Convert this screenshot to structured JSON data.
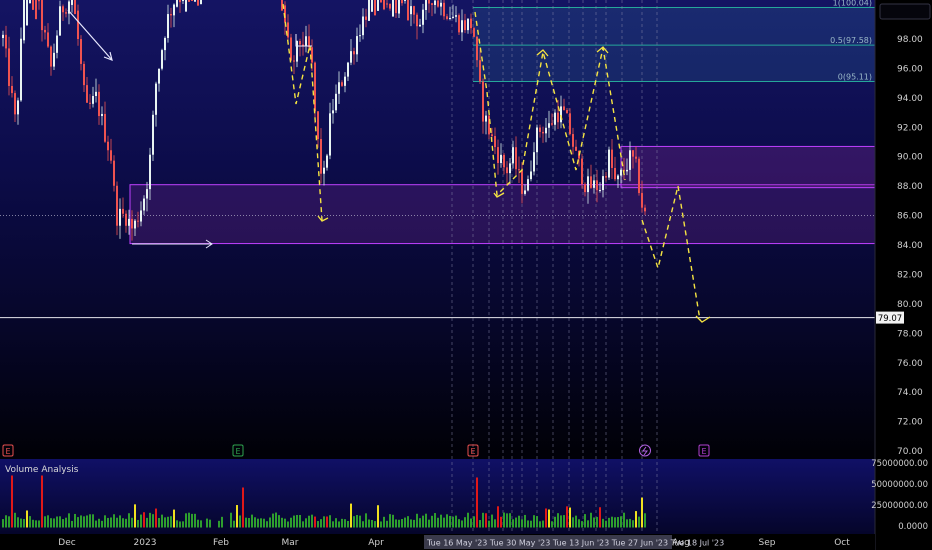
{
  "chart_data": {
    "type": "candlestick",
    "price_axis": {
      "ticks": [
        "98.00",
        "96.00",
        "94.00",
        "92.00",
        "90.00",
        "88.00",
        "86.00",
        "84.00",
        "82.00",
        "80.00",
        "78.00",
        "76.00",
        "74.00",
        "72.00",
        "70.00"
      ],
      "range": [
        69.2,
        100.6
      ]
    },
    "price_label": "79.07",
    "price_level": 79.07,
    "time_axis": {
      "ticks": [
        "Dec",
        "2023",
        "Feb",
        "Mar",
        "Apr",
        "Aug",
        "Sep",
        "Oct"
      ]
    },
    "date_labels_strip": "Tue 16 May '23  Tue 30 May '23  Tue 13 Jun '23  Tue 27 Jun '23  Tue 18 Jul '23",
    "fib_labels": [
      "1(100.04)",
      "0.5(97.58)",
      "0(95.11)"
    ],
    "fib_levels": [
      100.04,
      97.58,
      95.11
    ],
    "zones": [
      {
        "name": "lower demand zone",
        "top": 88.1,
        "bottom": 84.1
      },
      {
        "name": "upper supply zone",
        "top": 90.7,
        "bottom": 87.9
      }
    ],
    "volume_panel": {
      "title": "Volume Analysis",
      "ticks": [
        "75000000.00",
        "50000000.00",
        "25000000.00",
        "0.0000"
      ]
    },
    "event_markers": [
      "E",
      "E",
      "E",
      "E"
    ]
  },
  "colors": {
    "up": "#26a69a",
    "down": "#ef5350",
    "zone": "#c040ff",
    "fib": "#26a69a",
    "projection": "#f5e442",
    "vol_green": "#2e9e2e",
    "vol_red": "#e01818",
    "vol_yellow": "#f0e020",
    "event_red": "#e85050",
    "event_green": "#2ea44f",
    "event_purple": "#b040d0"
  }
}
